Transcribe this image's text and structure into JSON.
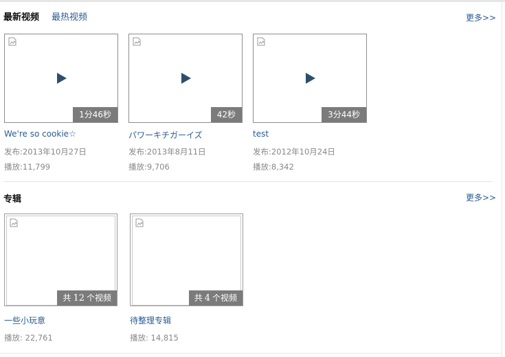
{
  "tabs": {
    "latest": "最新视频",
    "hottest": "最热视频"
  },
  "more_label": "更多>>",
  "videos": [
    {
      "title": "We're so cookie☆",
      "duration": "1分46秒",
      "date": "发布:2013年10月27日",
      "plays": "播放:11,799"
    },
    {
      "title": "パワーキチガーイズ",
      "duration": "42秒",
      "date": "发布:2013年8月11日",
      "plays": "播放:9,706"
    },
    {
      "title": "test",
      "duration": "3分44秒",
      "date": "发布:2012年10月24日",
      "plays": "播放:8,342"
    }
  ],
  "albums_section": {
    "title": "专辑",
    "count_prefix": "共",
    "count_suffix": "个视频",
    "items": [
      {
        "title": "一些小玩意",
        "count": "12",
        "plays": "播放: 22,761"
      },
      {
        "title": "待整理专辑",
        "count": "4",
        "plays": "播放: 14,815"
      }
    ]
  },
  "colors": {
    "link": "#2a5b93",
    "overlay": "#7b7b7b",
    "play": "#2f4e6c"
  },
  "icons": {
    "thumbnail": "broken-image-icon",
    "play": "play-icon"
  }
}
